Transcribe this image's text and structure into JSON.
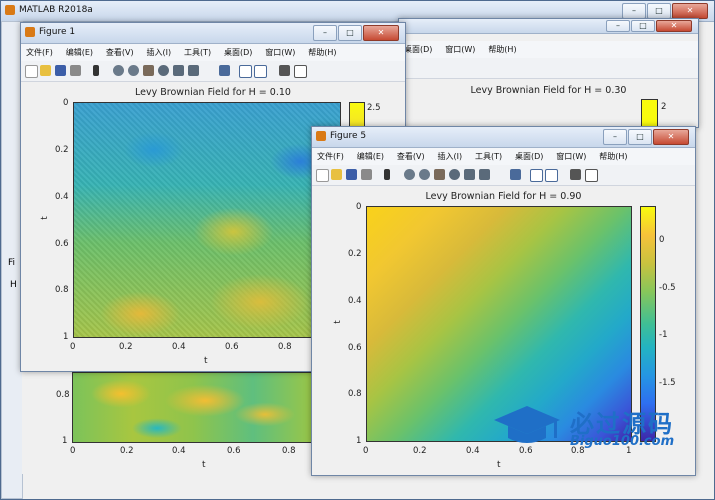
{
  "desktop": {
    "matlab_title": "MATLAB R2018a",
    "left_labels": [
      "Fi",
      "H"
    ]
  },
  "menus": [
    "文件(F)",
    "编辑(E)",
    "查看(V)",
    "插入(I)",
    "工具(T)",
    "桌面(D)",
    "窗口(W)",
    "帮助(H)"
  ],
  "figure1": {
    "window_title": "Figure 1",
    "plot_title": "Levy Brownian Field for H = 0.10",
    "xlabel": "t",
    "ylabel": "t",
    "xticks": [
      "0",
      "0.2",
      "0.4",
      "0.6",
      "0.8"
    ],
    "yticks": [
      "0",
      "0.2",
      "0.4",
      "0.6",
      "0.8",
      "1"
    ],
    "cbar_ticks": [
      "2.5"
    ]
  },
  "figure3": {
    "plot_title": "Levy Brownian Field for H = 0.30",
    "cbar_ticks": [
      "2"
    ],
    "xlabel": "t",
    "xticks": [
      "0",
      "0.2",
      "0.4",
      "0.6",
      "0.8"
    ],
    "yticks": [
      "0.8",
      "1"
    ]
  },
  "figure5": {
    "window_title": "Figure 5",
    "plot_title": "Levy Brownian Field for H = 0.90",
    "xlabel": "t",
    "ylabel": "t",
    "xticks": [
      "0",
      "0.2",
      "0.4",
      "0.6",
      "0.8",
      "1"
    ],
    "yticks": [
      "0",
      "0.2",
      "0.4",
      "0.6",
      "0.8",
      "1"
    ],
    "cbar_ticks": [
      "0",
      "-0.5",
      "-1",
      "-1.5"
    ]
  },
  "watermark": {
    "text": "必过源码",
    "url": "Biguo100.com"
  },
  "colors": {
    "parula_dark": "#3e26a8",
    "parula_blue": "#2e8cee",
    "parula_teal": "#26bdbb",
    "parula_green": "#91c84a",
    "parula_yellow": "#f9fb0e"
  }
}
